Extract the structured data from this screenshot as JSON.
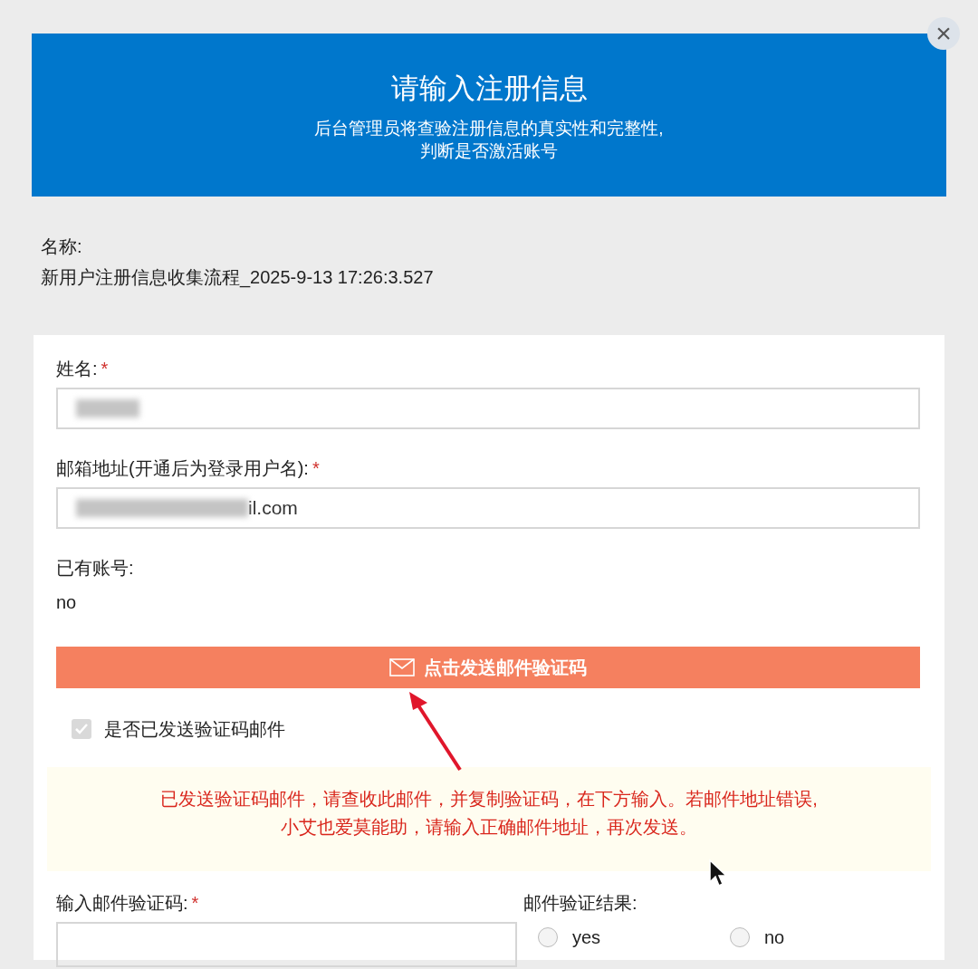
{
  "header": {
    "title": "请输入注册信息",
    "subtitle_lines": [
      "后台管理员将查验注册信息的真实性和完整性,",
      "判断是否激活账号"
    ]
  },
  "close_button": {
    "label": "×"
  },
  "process_name": {
    "label": "名称:",
    "value": "新用户注册信息收集流程_2025-9-13 17:26:3.527"
  },
  "form": {
    "fields": [
      {
        "kind": "input",
        "label": "姓名:",
        "required_mark": "*",
        "blurred": true
      },
      {
        "kind": "input",
        "label": "邮箱地址(开通后为登录用户名):",
        "required_mark": "*",
        "blurred": true,
        "value": "il.com"
      },
      {
        "kind": "readonly",
        "label": "已有账号:",
        "value": "no"
      }
    ],
    "send_button": {
      "label": "点击发送邮件验证码"
    },
    "sent_checkbox": {
      "label": "是否已发送验证码邮件",
      "checked": true,
      "disabled": true
    },
    "notice": {
      "lines": [
        "已发送验证码邮件，请查收此邮件，并复制验证码，在下方输入。若邮件地址错误,",
        "小艾也爱莫能助，请输入正确邮件地址，再次发送。"
      ]
    },
    "code_field": {
      "label": "输入邮件验证码:",
      "required_mark": "*"
    },
    "result": {
      "label": "邮件验证结果:",
      "options": [
        {
          "label": "yes",
          "selected": false
        },
        {
          "label": "no",
          "selected": false
        }
      ]
    }
  }
}
